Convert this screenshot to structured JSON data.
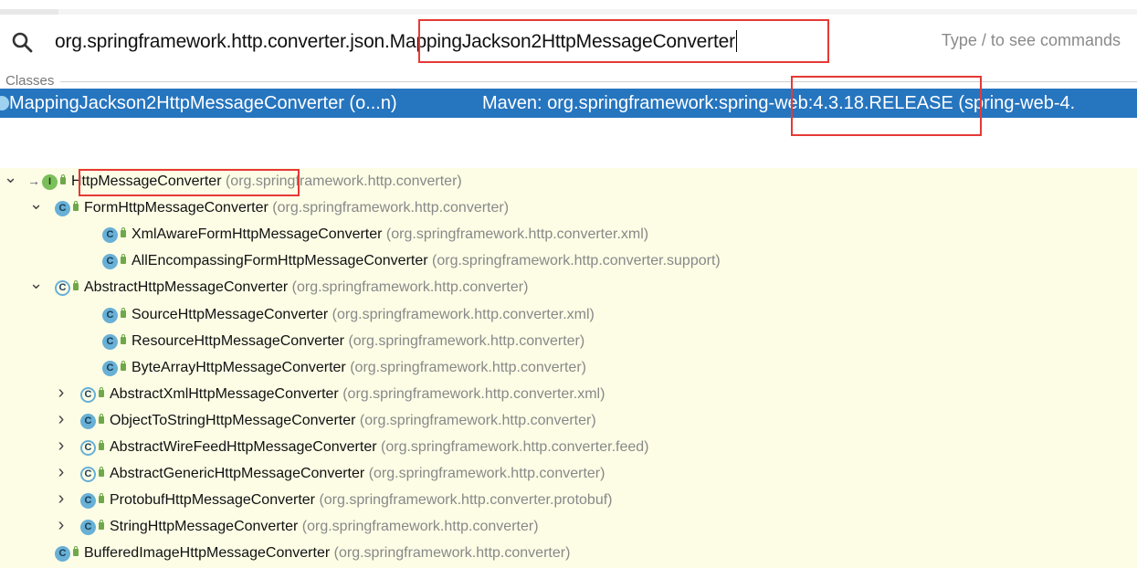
{
  "search": {
    "query": "org.springframework.http.converter.json.MappingJackson2HttpMessageConverter",
    "hint": "Type / to see commands"
  },
  "section": {
    "label": "Classes"
  },
  "result": {
    "name": "MappingJackson2HttpMessageConverter (o...n)",
    "location": "Maven: org.springframework:spring-web:4.3.18.RELEASE (spring-web-4."
  },
  "tree": [
    {
      "name": "HttpMessageConverter",
      "pkg": "(org.springframework.http.converter)",
      "kind": "interface",
      "expand": "down"
    },
    {
      "name": "FormHttpMessageConverter",
      "pkg": "(org.springframework.http.converter)",
      "kind": "class",
      "expand": "down"
    },
    {
      "name": "XmlAwareFormHttpMessageConverter",
      "pkg": "(org.springframework.http.converter.xml)",
      "kind": "class",
      "expand": ""
    },
    {
      "name": "AllEncompassingFormHttpMessageConverter",
      "pkg": "(org.springframework.http.converter.support)",
      "kind": "class",
      "expand": ""
    },
    {
      "name": "AbstractHttpMessageConverter",
      "pkg": "(org.springframework.http.converter)",
      "kind": "abstract",
      "expand": "down"
    },
    {
      "name": "SourceHttpMessageConverter",
      "pkg": "(org.springframework.http.converter.xml)",
      "kind": "class",
      "expand": ""
    },
    {
      "name": "ResourceHttpMessageConverter",
      "pkg": "(org.springframework.http.converter)",
      "kind": "class",
      "expand": ""
    },
    {
      "name": "ByteArrayHttpMessageConverter",
      "pkg": "(org.springframework.http.converter)",
      "kind": "class",
      "expand": ""
    },
    {
      "name": "AbstractXmlHttpMessageConverter",
      "pkg": "(org.springframework.http.converter.xml)",
      "kind": "abstract",
      "expand": "right"
    },
    {
      "name": "ObjectToStringHttpMessageConverter",
      "pkg": "(org.springframework.http.converter)",
      "kind": "class",
      "expand": "right"
    },
    {
      "name": "AbstractWireFeedHttpMessageConverter",
      "pkg": "(org.springframework.http.converter.feed)",
      "kind": "abstract",
      "expand": "right"
    },
    {
      "name": "AbstractGenericHttpMessageConverter",
      "pkg": "(org.springframework.http.converter)",
      "kind": "abstract",
      "expand": "right"
    },
    {
      "name": "ProtobufHttpMessageConverter",
      "pkg": "(org.springframework.http.converter.protobuf)",
      "kind": "class",
      "expand": "right"
    },
    {
      "name": "StringHttpMessageConverter",
      "pkg": "(org.springframework.http.converter)",
      "kind": "class",
      "expand": "right"
    },
    {
      "name": "BufferedImageHttpMessageConverter",
      "pkg": "(org.springframework.http.converter)",
      "kind": "class",
      "expand": ""
    }
  ],
  "icons": {
    "class_letter": "C",
    "interface_letter": "I",
    "accent": "#2675bf",
    "highlight": "#e53935",
    "tree_bg": "#fdfde6"
  }
}
